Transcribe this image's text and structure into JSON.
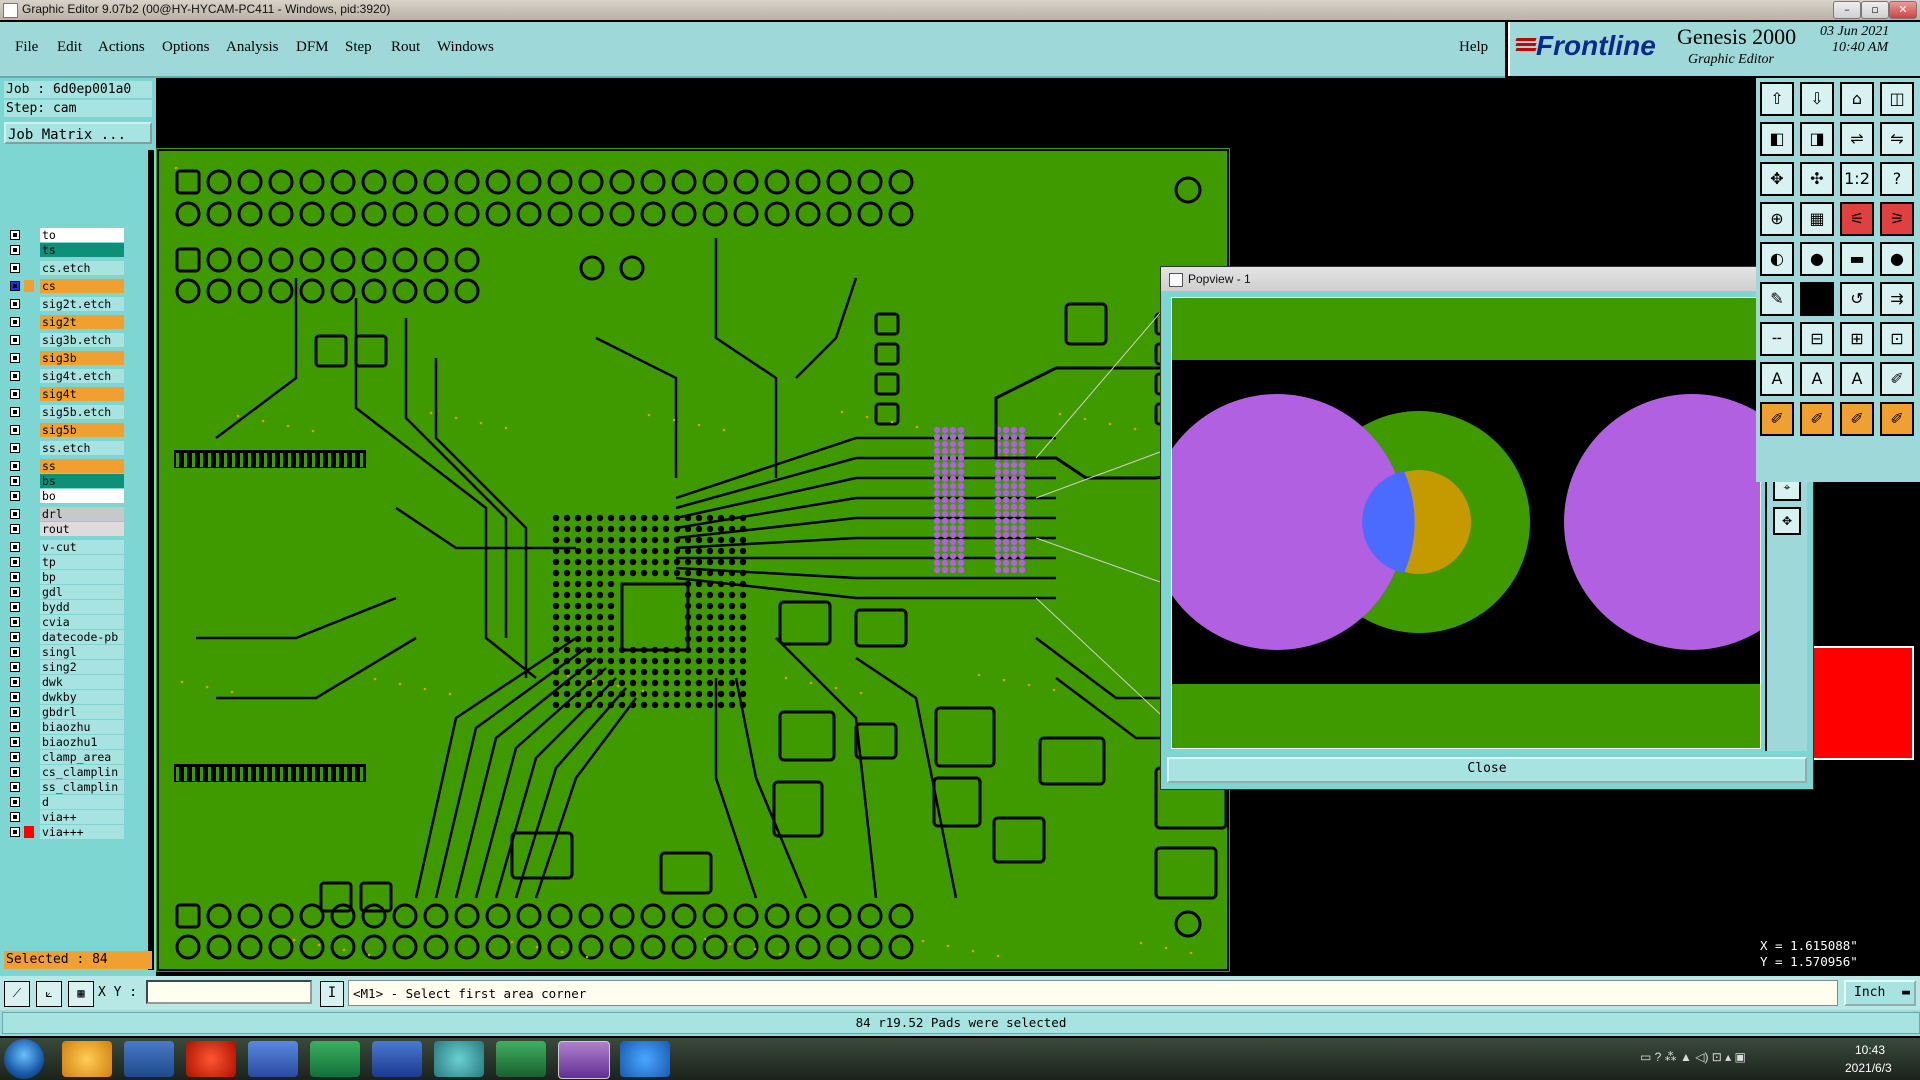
{
  "window": {
    "title": "Graphic Editor 9.07b2 (00@HY-HYCAM-PC411 - Windows, pid:3920)"
  },
  "menu": {
    "items": [
      "File",
      "Edit",
      "Actions",
      "Options",
      "Analysis",
      "DFM",
      "Step",
      "Rout",
      "Windows"
    ],
    "help": "Help"
  },
  "brand": {
    "logo": "Frontline",
    "product": "Genesis 2000",
    "subtitle": "Graphic Editor",
    "date": "03 Jun 2021",
    "time": "10:40 AM"
  },
  "job": {
    "job_line": "Job : 6d0ep001a0",
    "step_line": "Step: cam",
    "matrix_button": "Job Matrix ..."
  },
  "layers": [
    {
      "name": "to",
      "color": "#ffffff",
      "gap": 0
    },
    {
      "name": "ts",
      "color": "#0e8f78",
      "gap": 0
    },
    {
      "name": "cs.etch",
      "color": "#a7e3e0",
      "gap": 1
    },
    {
      "name": "cs",
      "color": "#f0a030",
      "gap": 1,
      "active": true
    },
    {
      "name": "sig2t.etch",
      "color": "#a7e3e0",
      "gap": 1
    },
    {
      "name": "sig2t",
      "color": "#f0a030",
      "gap": 1
    },
    {
      "name": "sig3b.etch",
      "color": "#a7e3e0",
      "gap": 1
    },
    {
      "name": "sig3b",
      "color": "#f0a030",
      "gap": 1
    },
    {
      "name": "sig4t.etch",
      "color": "#a7e3e0",
      "gap": 1
    },
    {
      "name": "sig4t",
      "color": "#f0a030",
      "gap": 1
    },
    {
      "name": "sig5b.etch",
      "color": "#a7e3e0",
      "gap": 1
    },
    {
      "name": "sig5b",
      "color": "#f0a030",
      "gap": 1
    },
    {
      "name": "ss.etch",
      "color": "#a7e3e0",
      "gap": 1
    },
    {
      "name": "ss",
      "color": "#f0a030",
      "gap": 1
    },
    {
      "name": "bs",
      "color": "#0e8f78",
      "gap": 0
    },
    {
      "name": "bo",
      "color": "#ffffff",
      "gap": 0
    },
    {
      "name": "drl",
      "color": "#c8c8c8",
      "gap": 1
    },
    {
      "name": "rout",
      "color": "#dcdcdc",
      "gap": 0
    },
    {
      "name": "v-cut",
      "color": "#a7e3e0",
      "gap": 1
    },
    {
      "name": "tp",
      "color": "#a7e3e0",
      "gap": 0
    },
    {
      "name": "bp",
      "color": "#a7e3e0",
      "gap": 0
    },
    {
      "name": "gdl",
      "color": "#a7e3e0",
      "gap": 0
    },
    {
      "name": "bydd",
      "color": "#a7e3e0",
      "gap": 0
    },
    {
      "name": "cvia",
      "color": "#a7e3e0",
      "gap": 0
    },
    {
      "name": "datecode-pb",
      "color": "#a7e3e0",
      "gap": 0
    },
    {
      "name": "singl",
      "color": "#a7e3e0",
      "gap": 0
    },
    {
      "name": "sing2",
      "color": "#a7e3e0",
      "gap": 0
    },
    {
      "name": "dwk",
      "color": "#a7e3e0",
      "gap": 0
    },
    {
      "name": "dwkby",
      "color": "#a7e3e0",
      "gap": 0
    },
    {
      "name": "gbdrl",
      "color": "#a7e3e0",
      "gap": 0
    },
    {
      "name": "biaozhu",
      "color": "#a7e3e0",
      "gap": 0
    },
    {
      "name": "biaozhu1",
      "color": "#a7e3e0",
      "gap": 0
    },
    {
      "name": "clamp_area",
      "color": "#a7e3e0",
      "gap": 0
    },
    {
      "name": "cs_clamplin",
      "color": "#a7e3e0",
      "gap": 0
    },
    {
      "name": "ss_clamplin",
      "color": "#a7e3e0",
      "gap": 0
    },
    {
      "name": "d",
      "color": "#a7e3e0",
      "gap": 0
    },
    {
      "name": "via++",
      "color": "#a7e3e0",
      "gap": 0
    },
    {
      "name": "via+++",
      "color": "#a7e3e0",
      "gap": 0,
      "swatch": "#ff0000"
    }
  ],
  "selected": "Selected : 84",
  "popview": {
    "title": "Popview - 1",
    "close_label": "Close"
  },
  "coords": {
    "x": "X = 1.615088\"",
    "y": "Y = 1.570956\""
  },
  "command": {
    "xy_label": "X Y :",
    "xy_value": "",
    "prompt": "<M1> - Select first area corner",
    "units": "Inch"
  },
  "status": {
    "message": "84 r19.52 Pads were selected"
  },
  "taskbar": {
    "time": "10:43",
    "date": "2021/6/3"
  },
  "colors": {
    "board": "#3f9a00",
    "pad_highlight": "#b060e0",
    "panel": "#7ed6d2"
  }
}
